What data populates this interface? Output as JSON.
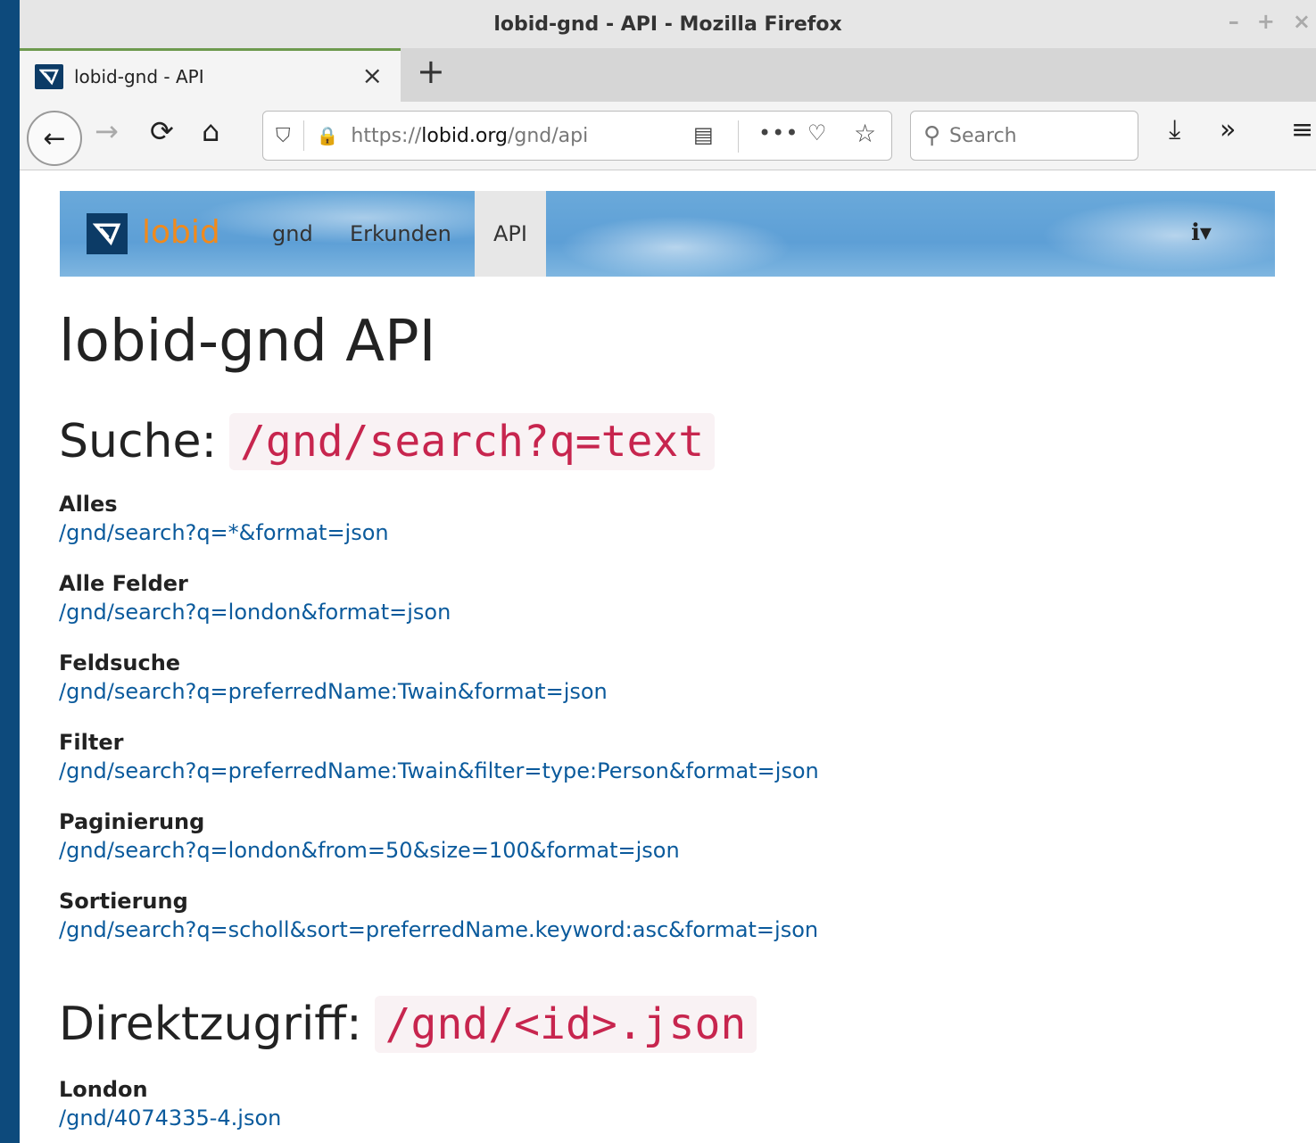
{
  "window": {
    "title": "lobid-gnd - API - Mozilla Firefox",
    "controls": [
      "–",
      "+",
      "×"
    ]
  },
  "tab": {
    "title": "lobid-gnd - API",
    "close": "×",
    "new_tab": "+"
  },
  "nav": {
    "url_prefix": "https://",
    "url_host": "lobid.org",
    "url_path": "/gnd/api",
    "search_placeholder": "Search"
  },
  "site": {
    "brand": "lobid",
    "links": [
      "gnd",
      "Erkunden",
      "API"
    ],
    "info": "ℹ▾"
  },
  "page": {
    "title": "lobid-gnd API",
    "search_heading": "Suche:",
    "search_code": "/gnd/search?q=text",
    "search_examples": [
      {
        "label": "Alles",
        "link": "/gnd/search?q=*&format=json"
      },
      {
        "label": "Alle Felder",
        "link": "/gnd/search?q=london&format=json"
      },
      {
        "label": "Feldsuche",
        "link": "/gnd/search?q=preferredName:Twain&format=json"
      },
      {
        "label": "Filter",
        "link": "/gnd/search?q=preferredName:Twain&filter=type:Person&format=json"
      },
      {
        "label": "Paginierung",
        "link": "/gnd/search?q=london&from=50&size=100&format=json"
      },
      {
        "label": "Sortierung",
        "link": "/gnd/search?q=scholl&sort=preferredName.keyword:asc&format=json"
      }
    ],
    "direct_heading": "Direktzugriff:",
    "direct_code": "/gnd/<id>.json",
    "direct_examples": [
      {
        "label": "London",
        "link": "/gnd/4074335-4.json"
      }
    ]
  }
}
